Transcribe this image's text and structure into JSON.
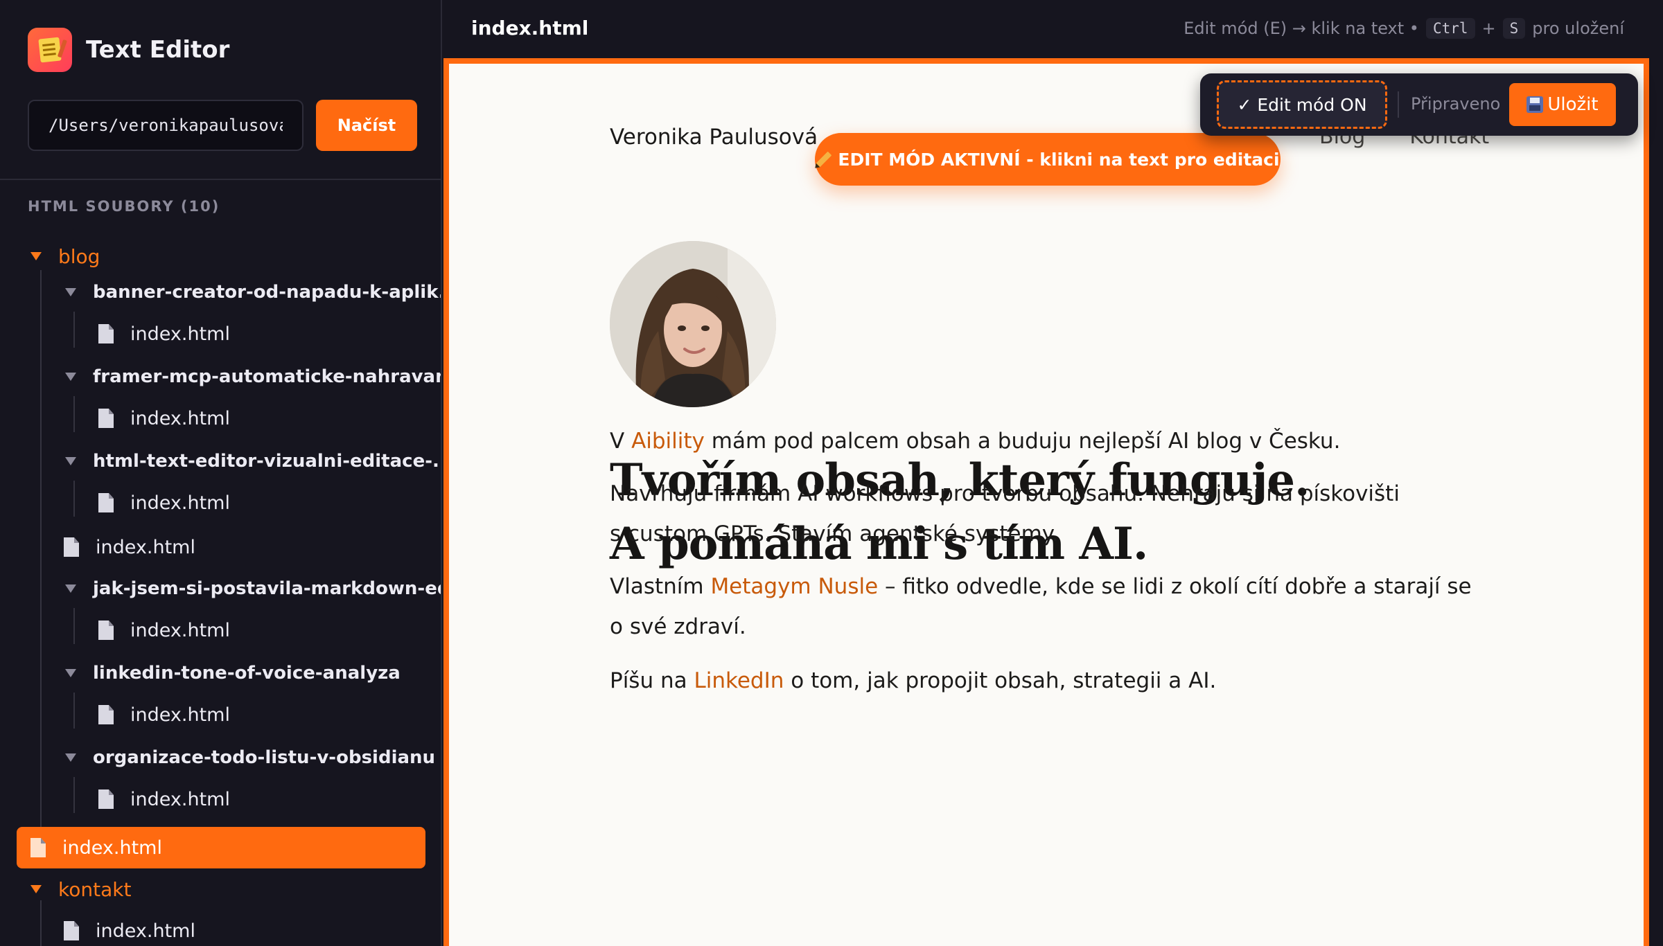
{
  "app": {
    "title": "Text Editor"
  },
  "sidebar": {
    "path_value": "/Users/veronikapaulusova",
    "load_label": "Načíst",
    "section_label": "HTML SOUBORY (10)",
    "tree": [
      {
        "label": "blog"
      },
      {
        "label": "banner-creator-od-napadu-k-aplik..."
      },
      {
        "label": "index.html"
      },
      {
        "label": "framer-mcp-automaticke-nahravani"
      },
      {
        "label": "index.html"
      },
      {
        "label": "html-text-editor-vizualni-editace-..."
      },
      {
        "label": "index.html"
      },
      {
        "label": "index.html"
      },
      {
        "label": "jak-jsem-si-postavila-markdown-ed..."
      },
      {
        "label": "index.html"
      },
      {
        "label": "linkedin-tone-of-voice-analyza"
      },
      {
        "label": "index.html"
      },
      {
        "label": "organizace-todo-listu-v-obsidianu"
      },
      {
        "label": "index.html"
      },
      {
        "label": "index.html"
      },
      {
        "label": "kontakt"
      },
      {
        "label": "index.html"
      }
    ]
  },
  "topbar": {
    "filename": "index.html",
    "hint_prefix": "Edit mód (E) → klik na text •",
    "kbd_ctrl": "Ctrl",
    "plus": "+",
    "kbd_s": "S",
    "hint_suffix": "pro uložení"
  },
  "toolbar": {
    "edit_toggle": "✓ Edit mód ON",
    "status": "Připraveno",
    "save_label": "Uložit"
  },
  "preview": {
    "site_name": "Veronika Paulusová",
    "nav": [
      "Blog",
      "Kontakt"
    ],
    "edit_banner": "EDIT MÓD AKTIVNÍ - klikni na text pro editaci",
    "headline_1": "Tvořím obsah, který funguje.",
    "headline_2": "A pomáhá mi s tím AI.",
    "p1_before": "V ",
    "p1_link": "Aibility",
    "p1_after": " mám pod palcem obsah a buduju nejlepší AI blog v Česku.",
    "p2_line1": "Navrhuju firmám AI workflows pro tvorbu obsahu. Nehraju si na pískovišti",
    "p2_line2": "s custom GPTs. Stavím agentské systémy.",
    "p3_before": "Vlastním ",
    "p3_link": "Metagym Nusle",
    "p3_after": " – fitko odvedle, kde se lidi z okolí cítí dobře a starají se o své zdraví.",
    "p4_before": "Píšu na ",
    "p4_link": "LinkedIn",
    "p4_after": " o tom, jak propojit obsah, strategii a AI."
  },
  "colors": {
    "accent": "#ff6a10",
    "link": "#c85a0a",
    "sidebar_bg": "#16151f",
    "page_bg": "#fbfaf7"
  }
}
